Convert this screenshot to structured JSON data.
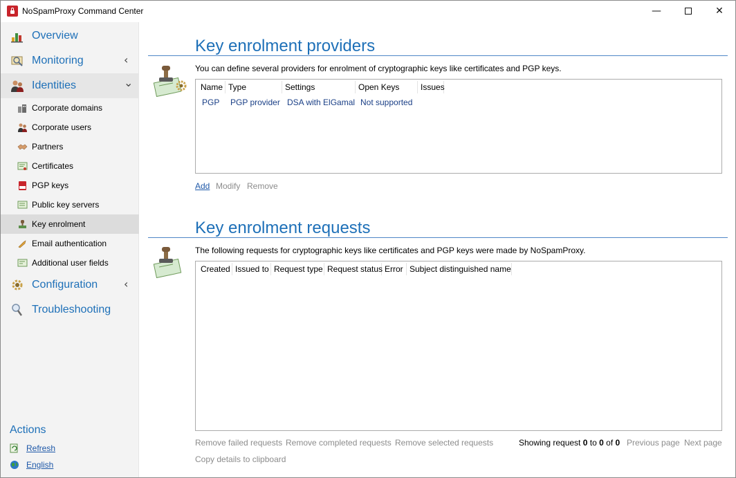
{
  "window": {
    "title": "NoSpamProxy Command Center",
    "minimize_glyph": "—",
    "close_glyph": "✕"
  },
  "sidebar": {
    "top_items": [
      {
        "label": "Overview",
        "icon": "overview-icon"
      },
      {
        "label": "Monitoring",
        "icon": "monitoring-icon",
        "chevron": "‹"
      },
      {
        "label": "Identities",
        "icon": "identities-icon",
        "chevron": "⌄"
      },
      {
        "label": "Configuration",
        "icon": "configuration-icon",
        "chevron": "‹"
      },
      {
        "label": "Troubleshooting",
        "icon": "troubleshooting-icon"
      }
    ],
    "identities_items": [
      {
        "label": "Corporate domains",
        "icon": "corporate-domains-icon"
      },
      {
        "label": "Corporate users",
        "icon": "corporate-users-icon"
      },
      {
        "label": "Partners",
        "icon": "partners-icon"
      },
      {
        "label": "Certificates",
        "icon": "certificates-icon"
      },
      {
        "label": "PGP keys",
        "icon": "pgp-keys-icon"
      },
      {
        "label": "Public key servers",
        "icon": "public-key-servers-icon"
      },
      {
        "label": "Key enrolment",
        "icon": "key-enrolment-icon",
        "selected": true
      },
      {
        "label": "Email authentication",
        "icon": "email-authentication-icon"
      },
      {
        "label": "Additional user fields",
        "icon": "additional-user-fields-icon"
      }
    ],
    "actions": {
      "title": "Actions",
      "refresh": "Refresh",
      "language": "English"
    }
  },
  "providers": {
    "title": "Key enrolment providers",
    "description": "You can define several providers for enrolment of cryptographic keys like certificates and PGP keys.",
    "columns": [
      "Name",
      "Type",
      "Settings",
      "Open Keys",
      "Issues"
    ],
    "rows": [
      [
        "PGP",
        "PGP provider",
        "DSA with ElGamal",
        "Not supported",
        ""
      ]
    ],
    "actions": {
      "add": "Add",
      "modify": "Modify",
      "remove": "Remove"
    }
  },
  "requests": {
    "title": "Key enrolment requests",
    "description": "The following requests for cryptographic keys like certificates and PGP keys were made by NoSpamProxy.",
    "columns": [
      "Created",
      "Issued to",
      "Request type",
      "Request status",
      "Error",
      "Subject distinguished name"
    ],
    "rows": [],
    "actions": {
      "remove_failed": "Remove failed requests",
      "remove_completed": "Remove completed requests",
      "remove_selected": "Remove selected requests",
      "copy_details": "Copy details to clipboard"
    },
    "paging": {
      "showing_prefix": "Showing request",
      "from": "0",
      "to_word": "to",
      "to": "0",
      "of_word": "of",
      "total": "0",
      "previous": "Previous page",
      "next": "Next page"
    }
  },
  "colors": {
    "accent": "#1e70b8",
    "link": "#1e58a8",
    "disabled": "#8c8c8c",
    "sidebar_bg": "#f3f3f3"
  }
}
